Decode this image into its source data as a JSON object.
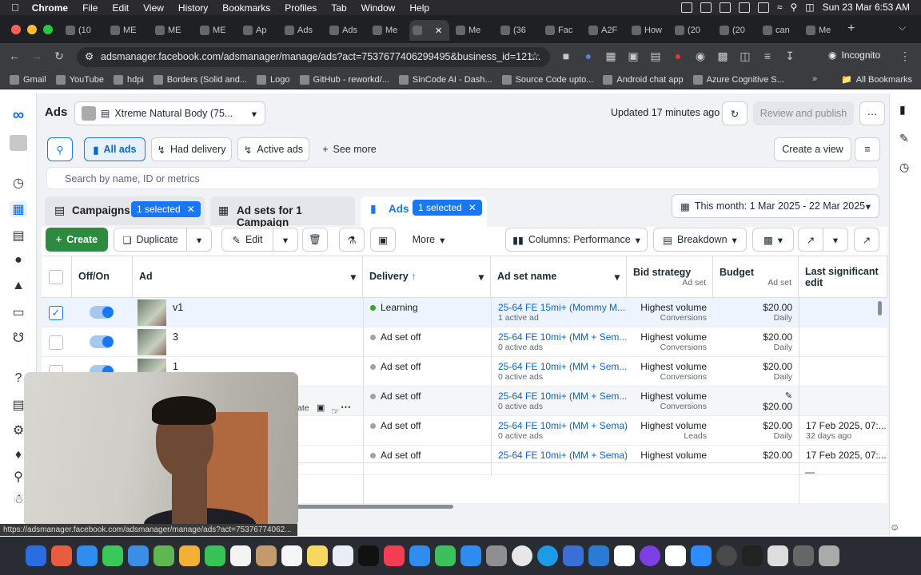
{
  "menubar": {
    "app": "Chrome",
    "items": [
      "File",
      "Edit",
      "View",
      "History",
      "Bookmarks",
      "Profiles",
      "Tab",
      "Window",
      "Help"
    ],
    "datetime": "Sun 23 Mar  6:53 AM"
  },
  "tabs": [
    {
      "label": "(10"
    },
    {
      "label": "ME"
    },
    {
      "label": "ME"
    },
    {
      "label": "ME"
    },
    {
      "label": "Ap"
    },
    {
      "label": "Ads"
    },
    {
      "label": "Ads"
    },
    {
      "label": "Me"
    },
    {
      "label": ""
    },
    {
      "label": "Me"
    },
    {
      "label": "(36"
    },
    {
      "label": "Fac"
    },
    {
      "label": "A2F"
    },
    {
      "label": "How"
    },
    {
      "label": "(20"
    },
    {
      "label": "(20"
    },
    {
      "label": "can"
    },
    {
      "label": "Me"
    }
  ],
  "address": {
    "url": "adsmanager.facebook.com/adsmanager/manage/ads?act=7537677406299495&business_id=121...",
    "profile": "Incognito"
  },
  "bookmarks": [
    "Gmail",
    "YouTube",
    "hdpi",
    "Borders (Solid and...",
    "Logo",
    "GitHub - reworkd/...",
    "SinCode AI - Dash...",
    "Source Code upto...",
    "Android chat app",
    "Azure Cognitive S..."
  ],
  "all_bookmarks": "All Bookmarks",
  "header": {
    "title": "Ads",
    "account": "Xtreme Natural Body (75...",
    "updated": "Updated 17 minutes ago",
    "review_publish": "Review and publish"
  },
  "filters": {
    "all_ads": "All ads",
    "had_delivery": "Had delivery",
    "active_ads": "Active ads",
    "see_more": "See more",
    "create_view": "Create a view",
    "search_placeholder": "Search by name, ID or metrics"
  },
  "levels": {
    "campaigns": "Campaigns",
    "campaigns_selected": "1 selected",
    "adsets": "Ad sets for 1 Campaign",
    "ads": "Ads",
    "ads_selected": "1 selected",
    "date_range": "This month: 1 Mar 2025 - 22 Mar 2025"
  },
  "actions": {
    "create": "Create",
    "duplicate": "Duplicate",
    "edit": "Edit",
    "more": "More",
    "columns": "Columns: Performance",
    "breakdown": "Breakdown"
  },
  "table": {
    "headers": {
      "offon": "Off/On",
      "ad": "Ad",
      "delivery": "Delivery",
      "adset": "Ad set name",
      "bid": "Bid strategy",
      "bid_sub": "Ad set",
      "budget": "Budget",
      "budget_sub": "Ad set",
      "last_edit": "Last significant edit"
    },
    "rows": [
      {
        "ad": "v1",
        "delivery": "Learning",
        "adset": "25-64 FE 15mi+ (Mommy M...",
        "adset_sub": "1 active ad",
        "bid": "Highest volume",
        "bid_sub": "Conversions",
        "budget": "$20.00",
        "budget_sub": "Daily",
        "edit": "",
        "edit_sub": "",
        "checked": true
      },
      {
        "ad": "3",
        "delivery": "Ad set off",
        "adset": "25-64 FE 10mi+ (MM + Sem...",
        "adset_sub": "0 active ads",
        "bid": "Highest volume",
        "bid_sub": "Conversions",
        "budget": "$20.00",
        "budget_sub": "Daily",
        "edit": "",
        "edit_sub": "",
        "checked": false
      },
      {
        "ad": "1",
        "delivery": "Ad set off",
        "adset": "25-64 FE 10mi+ (MM + Sem...",
        "adset_sub": "0 active ads",
        "bid": "Highest volume",
        "bid_sub": "Conversions",
        "budget": "$20.00",
        "budget_sub": "Daily",
        "edit": "",
        "edit_sub": "",
        "checked": false
      },
      {
        "ad": "",
        "delivery": "Ad set off",
        "adset": "25-64 FE 10mi+ (MM + Sem...",
        "adset_sub": "0 active ads",
        "bid": "Highest volume",
        "bid_sub": "Conversions",
        "budget": "$20.00",
        "budget_sub": "",
        "edit": "",
        "edit_sub": "",
        "checked": false
      },
      {
        "ad": "",
        "delivery": "Ad set off",
        "adset": "25-64 FE 10mi+ (MM + Sema)",
        "adset_sub": "0 active ads",
        "bid": "Highest volume",
        "bid_sub": "Leads",
        "budget": "$20.00",
        "budget_sub": "Daily",
        "edit": "17 Feb 2025, 07:...",
        "edit_sub": "32 days ago",
        "checked": false
      },
      {
        "ad": "",
        "delivery": "Ad set off",
        "adset": "25-64 FE 10mi+ (MM + Sema)",
        "adset_sub": "",
        "bid": "Highest volume",
        "bid_sub": "",
        "budget": "$20.00",
        "budget_sub": "",
        "edit": "17 Feb 2025, 07:...",
        "edit_sub": "",
        "checked": false
      }
    ],
    "row_hover_label": "ate",
    "footer_dash": "—"
  },
  "status_url": "https://adsmanager.facebook.com/adsmanager/manage/ads?act=75376774062..."
}
